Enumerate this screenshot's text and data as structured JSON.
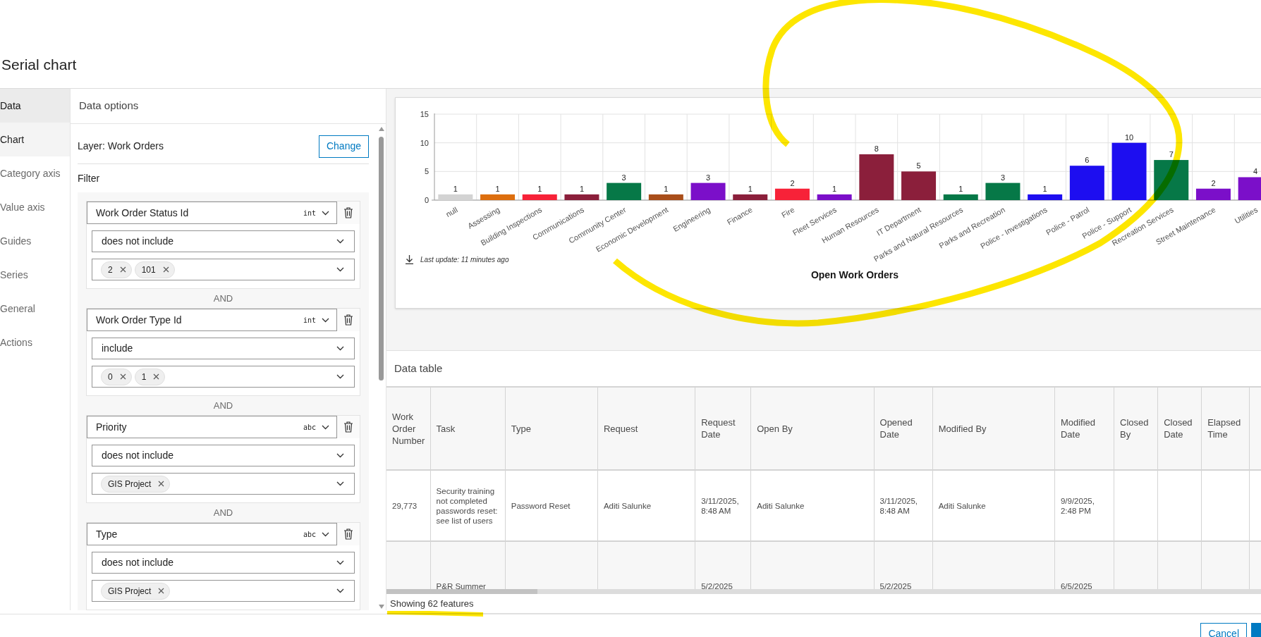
{
  "dialog": {
    "title": "Serial chart"
  },
  "nav": [
    {
      "label": "Data",
      "selected": true,
      "hovered": false
    },
    {
      "label": "Chart",
      "selected": false,
      "hovered": true
    },
    {
      "label": "Category axis",
      "selected": false,
      "hovered": false
    },
    {
      "label": "Value axis",
      "selected": false,
      "hovered": false
    },
    {
      "label": "Guides",
      "selected": false,
      "hovered": false
    },
    {
      "label": "Series",
      "selected": false,
      "hovered": false
    },
    {
      "label": "General",
      "selected": false,
      "hovered": false
    },
    {
      "label": "Actions",
      "selected": false,
      "hovered": false
    }
  ],
  "data_options": {
    "title": "Data options",
    "layer": "Layer: Work Orders",
    "change_button": "Change",
    "filter_label": "Filter",
    "clauses": [
      {
        "field": "Work Order Status Id",
        "field_type": "int",
        "operator": "does not include",
        "values": [
          "2",
          "101"
        ],
        "joiner": "AND"
      },
      {
        "field": "Work Order Type Id",
        "field_type": "int",
        "operator": "include",
        "values": [
          "0",
          "1"
        ],
        "joiner": "AND"
      },
      {
        "field": "Priority",
        "field_type": "abc",
        "operator": "does not include",
        "values": [
          "GIS Project"
        ],
        "joiner": "AND"
      },
      {
        "field": "Type",
        "field_type": "abc",
        "operator": "does not include",
        "values": [
          "GIS Project"
        ]
      }
    ]
  },
  "chart": {
    "chart_data": {
      "type": "bar",
      "title": "Open Work Orders",
      "categories": [
        "null",
        "Assessing",
        "Building Inspections",
        "Communications",
        "Community Center",
        "Economic Development",
        "Engineering",
        "Finance",
        "Fire",
        "Fleet Services",
        "Human Resources",
        "IT Department",
        "Parks and Natural Resources",
        "Parks and Recreation",
        "Police - Investigations",
        "Police - Patrol",
        "Police - Support",
        "Recreation Services",
        "Street Maintenance",
        "Utilities"
      ],
      "values": [
        1,
        1,
        1,
        1,
        3,
        1,
        3,
        1,
        2,
        1,
        8,
        5,
        1,
        3,
        1,
        6,
        10,
        7,
        2,
        4
      ],
      "colors": [
        "#d3d3d3",
        "#dd6e0e",
        "#f72238",
        "#8b1f3b",
        "#067847",
        "#a94e1a",
        "#7b0fc9",
        "#8b1f3b",
        "#f72238",
        "#7b0fc9",
        "#8b1f3b",
        "#8b1f3b",
        "#067847",
        "#067847",
        "#1d0ef0",
        "#1d0ef0",
        "#1d0ef0",
        "#067847",
        "#7b0fc9",
        "#7b0fc9"
      ],
      "ylim": [
        0,
        15
      ],
      "yticks": [
        0,
        5,
        10,
        15
      ],
      "data_labels": true
    },
    "last_update": "Last update: 11 minutes ago"
  },
  "data_table": {
    "title": "Data table",
    "columns": [
      "Work Order Number",
      "Task",
      "Type",
      "Request",
      "Request Date",
      "Open By",
      "Opened Date",
      "Modified By",
      "Modified Date",
      "Closed By",
      "Closed Date",
      "Elapsed Time"
    ],
    "rows": [
      [
        "29,773",
        "Security training not completed passwords reset: see list of users",
        "Password Reset",
        "Aditi Salunke",
        "3/11/2025, 8:48 AM",
        "Aditi Salunke",
        "3/11/2025, 8:48 AM",
        "Aditi Salunke",
        "9/9/2025, 2:48 PM",
        null,
        null,
        null
      ],
      [
        null,
        "P&R Summer",
        null,
        null,
        "5/2/2025",
        null,
        "5/2/2025",
        null,
        "6/5/2025",
        null,
        null,
        null
      ]
    ],
    "status": "Showing 62 features"
  },
  "footer": {
    "buttons": [
      "Cancel"
    ]
  }
}
